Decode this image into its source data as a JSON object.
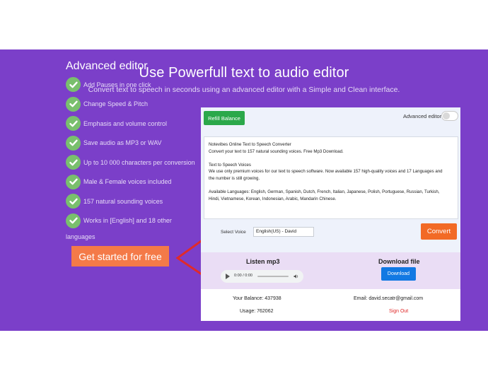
{
  "hero": {
    "title": "Use Powerfull text to audio editor",
    "subtitle": "Convert text to speech in seconds using an advanced editor with a Simple and Clean interface."
  },
  "features": {
    "heading": "Advanced editor",
    "items": [
      "Add Pauses in one click",
      "Change Speed & Pitch",
      "Emphasis and volume control",
      "Save audio as MP3 or WAV",
      "Up to 10 000 characters per conversion",
      "Male & Female voices included",
      "157 natural sounding voices",
      "Works in [English] and 18 other"
    ],
    "last_item_tail": "languages",
    "cta_label": "Get started for free",
    "check_color": "#79bf6d",
    "cta_color": "#f47a48",
    "arrow_color": "#e02a2a"
  },
  "editor": {
    "refill_label": "Refill Balance",
    "advanced_toggle_label": "Advanced editor",
    "advanced_toggle_on": false,
    "text_lines": [
      "Notevibes Online Text to Speech Converter",
      "Convert your text to 157 natural sounding voices. Free Mp3 Download.",
      "",
      "Text to Speech Voices",
      "We use only premium voices for our text to speech software. Now available 157 high-quality voices and 17 Languages and",
      "the number is still growing.",
      "",
      "Available Languages: English, German, Spanish, Dutch, French, Italian, Japanese, Polish, Portuguese, Russian, Turkish,",
      "Hindi, Vietnamese, Korean, Indonesian, Arabic, Mandarin Chinese."
    ],
    "voice_label": "Select Voice",
    "voice_value": "English(US) - David",
    "convert_label": "Convert",
    "listen_title": "Listen mp3",
    "player_time": "0:00 / 0:00",
    "download_title": "Download file",
    "download_label": "Download",
    "balance_text": "Your Balance: 437938",
    "usage_text": "Usage: 762062",
    "email_text": "Email: david.secatr@gmail.com",
    "signout_label": "Sign Out"
  },
  "colors": {
    "hero_bg": "#7b3fc9",
    "refill_bg": "#2ba84a",
    "convert_bg": "#f26a25",
    "download_bg": "#1279e3",
    "listen_bg": "#eaddf5"
  }
}
